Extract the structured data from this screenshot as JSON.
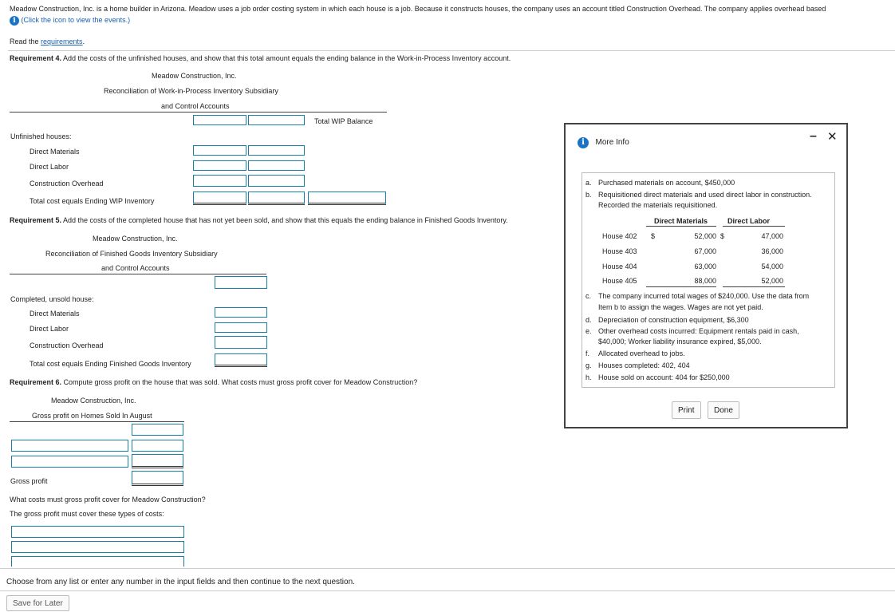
{
  "intro": {
    "text": "Meadow Construction, Inc. is a home builder in Arizona. Meadow uses a job order costing system in which each house is a job. Because it constructs houses, the company uses an account titled Construction Overhead. The company applies overhead based",
    "events_link": "(Click the icon to view the events.)",
    "read_prefix": "Read the ",
    "requirements_link": "requirements",
    "read_suffix": "."
  },
  "req4": {
    "label": "Requirement 4.",
    "text": " Add the costs of the unfinished houses, and show that this total amount equals the ending balance in the Work-in-Process Inventory account.",
    "company": "Meadow Construction, Inc.",
    "title1": "Reconciliation of Work-in-Process Inventory Subsidiary",
    "title2": "and Control Accounts",
    "col_header": "Total WIP Balance",
    "section": "Unfinished houses:",
    "rows": [
      "Direct Materials",
      "Direct Labor",
      "Construction Overhead",
      "Total cost equals Ending WIP Inventory"
    ]
  },
  "req5": {
    "label": "Requirement 5.",
    "text": " Add the costs of the completed house that has not yet been sold, and show that this equals the ending balance in Finished Goods Inventory.",
    "company": "Meadow Construction, Inc.",
    "title1": "Reconciliation of Finished Goods Inventory Subsidiary",
    "title2": "and Control Accounts",
    "section": "Completed, unsold house:",
    "rows": [
      "Direct Materials",
      "Direct Labor",
      "Construction Overhead",
      "Total cost equals Ending Finished Goods Inventory"
    ]
  },
  "req6": {
    "label": "Requirement 6.",
    "text": " Compute gross profit on the house that was sold. What costs must gross profit cover for Meadow Construction?",
    "company": "Meadow Construction, Inc.",
    "title": "Gross profit on Homes Sold In August",
    "gross_profit": "Gross profit",
    "question": "What costs must gross profit cover for Meadow Construction?",
    "answer_prefix": "The gross profit must cover these types of costs:"
  },
  "footer": {
    "instruction": "Choose from any list or enter any number in the input fields and then continue to the next question.",
    "save_button": "Save for Later"
  },
  "dialog": {
    "title": "More Info",
    "minimize": "–",
    "close": "✕",
    "items": [
      {
        "letter": "a.",
        "text": "Purchased materials on account, $450,000"
      },
      {
        "letter": "b.",
        "text": "Requisitioned direct materials and used direct labor in construction.",
        "text2": "Recorded the materials requisitioned."
      }
    ],
    "table": {
      "headers": [
        "Direct Materials",
        "Direct Labor"
      ],
      "rows": [
        {
          "house": "House 402",
          "sign": "$",
          "dm": "52,000",
          "sign2": "$",
          "dl": "47,000"
        },
        {
          "house": "House 403",
          "sign": "",
          "dm": "67,000",
          "sign2": "",
          "dl": "36,000"
        },
        {
          "house": "House 404",
          "sign": "",
          "dm": "63,000",
          "sign2": "",
          "dl": "54,000"
        },
        {
          "house": "House 405",
          "sign": "",
          "dm": "88,000",
          "sign2": "",
          "dl": "52,000"
        }
      ]
    },
    "items2": [
      {
        "letter": "c.",
        "text": "The company incurred total wages of $240,000. Use the data from",
        "text2": "Item b to assign the wages. Wages are not yet paid."
      },
      {
        "letter": "d.",
        "text": "Depreciation of construction equipment, $6,300"
      },
      {
        "letter": "e.",
        "text": "Other overhead costs incurred: Equipment rentals paid in cash,",
        "text2": "$40,000; Worker liability insurance expired, $5,000."
      },
      {
        "letter": "f.",
        "text": "Allocated overhead to jobs."
      },
      {
        "letter": "g.",
        "text": "Houses completed: 402, 404"
      },
      {
        "letter": "h.",
        "text": "House sold on account: 404 for $250,000"
      }
    ],
    "print_button": "Print",
    "done_button": "Done"
  }
}
